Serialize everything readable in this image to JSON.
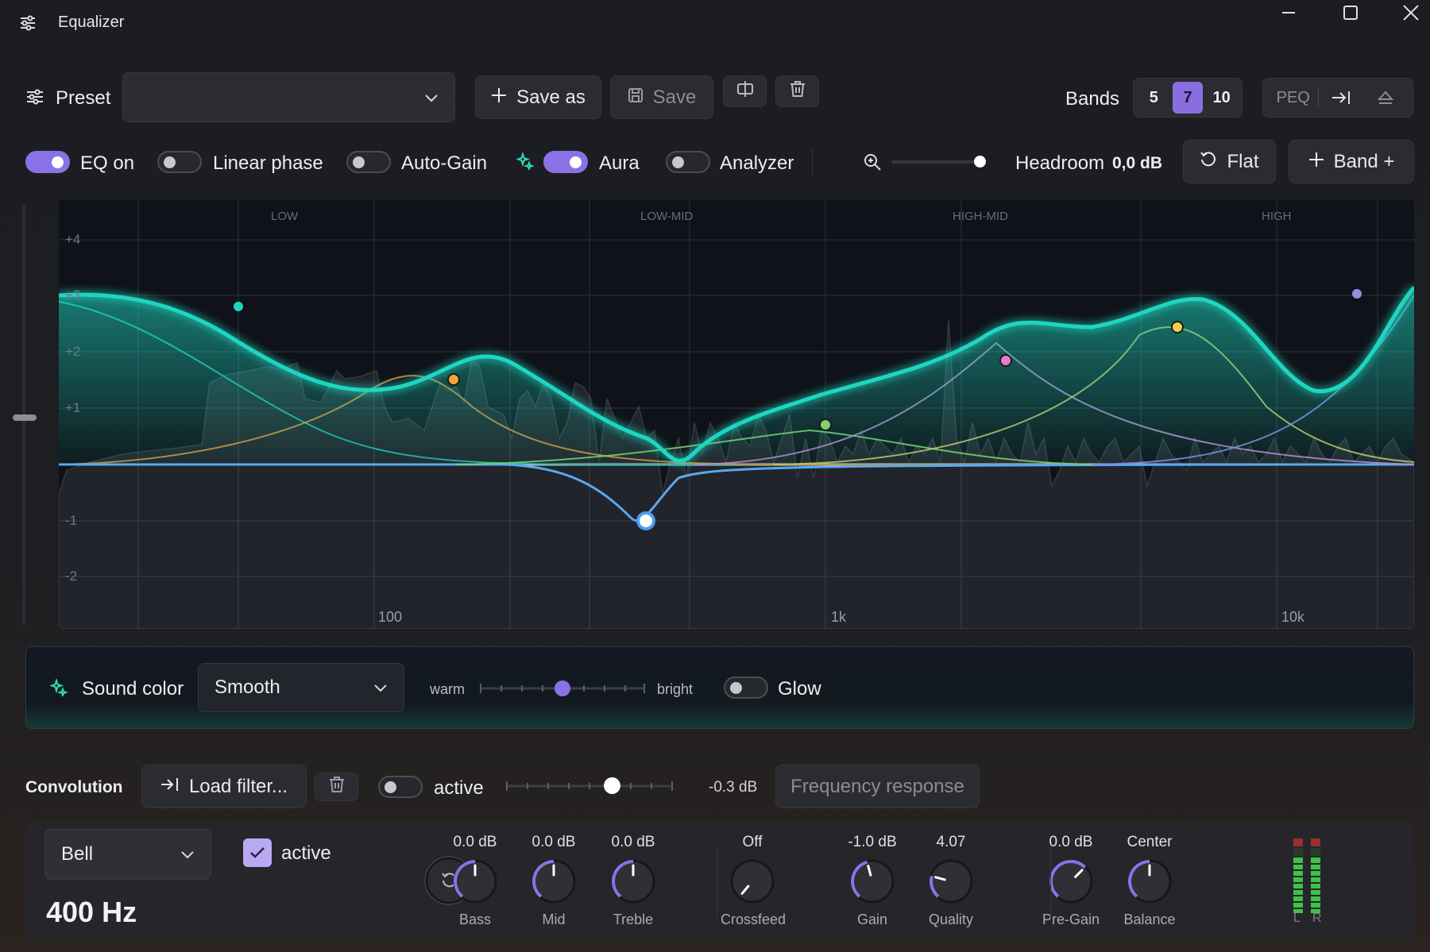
{
  "window": {
    "title": "Equalizer"
  },
  "toolbar": {
    "preset_label": "Preset",
    "preset_value": "",
    "save_as_label": "Save as",
    "save_label": "Save",
    "bands_label": "Bands",
    "bands_options": [
      "5",
      "7",
      "10"
    ],
    "bands_selected": "7",
    "peq_label": "PEQ"
  },
  "options": {
    "eq_on": {
      "label": "EQ on",
      "on": true
    },
    "linear_phase": {
      "label": "Linear phase",
      "on": false
    },
    "auto_gain": {
      "label": "Auto-Gain",
      "on": false
    },
    "aura": {
      "label": "Aura",
      "on": true
    },
    "analyzer": {
      "label": "Analyzer",
      "on": false
    },
    "headroom_label": "Headroom",
    "headroom_value": "0,0 dB",
    "flat_label": "Flat",
    "band_label": "Band +"
  },
  "graph": {
    "region_labels": [
      "LOW",
      "LOW-MID",
      "HIGH-MID",
      "HIGH"
    ],
    "y_ticks": [
      "+4",
      "+3",
      "+2",
      "+1",
      "-1",
      "-2"
    ],
    "x_ticks": [
      "100",
      "1k",
      "10k"
    ]
  },
  "sound_color": {
    "label": "Sound color",
    "mode": "Smooth",
    "warm_label": "warm",
    "bright_label": "bright",
    "level": 0.5,
    "glow_label": "Glow",
    "glow_on": false
  },
  "convolution": {
    "label": "Convolution",
    "load_label": "Load filter...",
    "active_label": "active",
    "active_on": false,
    "level_value": "-0.3 dB",
    "freq_response_label": "Frequency response"
  },
  "band_editor": {
    "filter_type": "Bell",
    "active_label": "active",
    "active_checked": true,
    "frequency": "400 Hz",
    "knobs": [
      {
        "name": "Bass",
        "value": "0.0 dB"
      },
      {
        "name": "Mid",
        "value": "0.0 dB"
      },
      {
        "name": "Treble",
        "value": "0.0 dB"
      },
      {
        "name": "Crossfeed",
        "value": "Off"
      },
      {
        "name": "Gain",
        "value": "-1.0 dB"
      },
      {
        "name": "Quality",
        "value": "4.07"
      },
      {
        "name": "Pre-Gain",
        "value": "0.0 dB"
      },
      {
        "name": "Balance",
        "value": "Center"
      }
    ],
    "meter_labels": [
      "L",
      "R"
    ]
  },
  "colors": {
    "accent": "#8a72e6",
    "curve": "#1ed6c0",
    "band_orange": "#f3a63a",
    "band_blue": "#5aa8f0",
    "band_green": "#7ed36a",
    "band_pink": "#e57bd0",
    "band_yellow": "#f0d050",
    "band_purple": "#9a8ae8"
  }
}
